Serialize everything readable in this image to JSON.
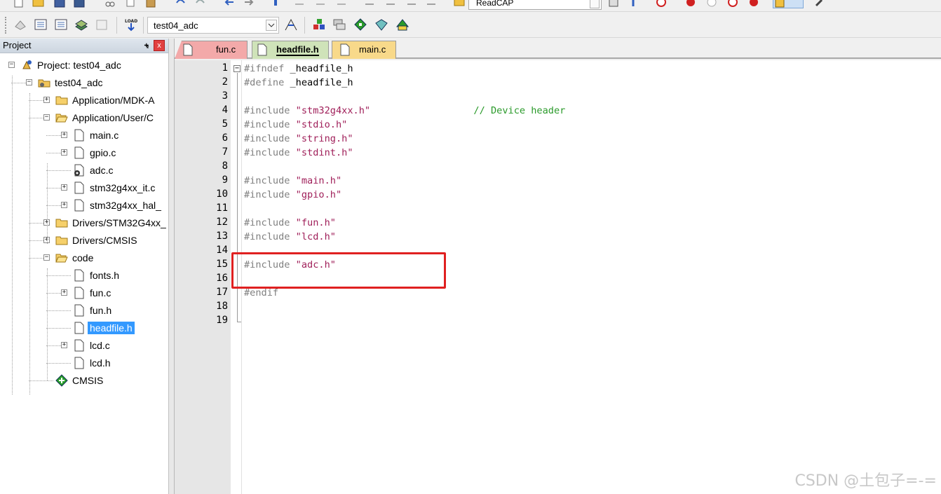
{
  "toolbar_top": {
    "combo_text": "ReadCAP"
  },
  "toolbar": {
    "target_name": "test04_adc",
    "load_label": "LOAD"
  },
  "project_panel": {
    "title": "Project",
    "pin_glyph": "⨧",
    "close_glyph": "x",
    "tree": [
      {
        "label": "Project: test04_adc",
        "icon": "project-icon",
        "level": 0,
        "expander": "−"
      },
      {
        "label": "test04_adc",
        "icon": "target-folder-icon",
        "level": 1,
        "expander": "−"
      },
      {
        "label": "Application/MDK-A",
        "icon": "folder-icon",
        "level": 2,
        "expander": "+"
      },
      {
        "label": "Application/User/C",
        "icon": "folder-open-icon",
        "level": 2,
        "expander": "−"
      },
      {
        "label": "main.c",
        "icon": "file-icon",
        "level": 3,
        "expander": "+"
      },
      {
        "label": "gpio.c",
        "icon": "file-icon",
        "level": 3,
        "expander": "+"
      },
      {
        "label": "adc.c",
        "icon": "file-gear-icon",
        "level": 3,
        "expander": ""
      },
      {
        "label": "stm32g4xx_it.c",
        "icon": "file-icon",
        "level": 3,
        "expander": "+"
      },
      {
        "label": "stm32g4xx_hal_",
        "icon": "file-icon",
        "level": 3,
        "expander": "+"
      },
      {
        "label": "Drivers/STM32G4xx_",
        "icon": "folder-icon",
        "level": 2,
        "expander": "+"
      },
      {
        "label": "Drivers/CMSIS",
        "icon": "folder-icon",
        "level": 2,
        "expander": "+"
      },
      {
        "label": "code",
        "icon": "folder-open-icon",
        "level": 2,
        "expander": "−"
      },
      {
        "label": "fonts.h",
        "icon": "file-icon",
        "level": 3,
        "expander": ""
      },
      {
        "label": "fun.c",
        "icon": "file-icon",
        "level": 3,
        "expander": "+"
      },
      {
        "label": "fun.h",
        "icon": "file-icon",
        "level": 3,
        "expander": ""
      },
      {
        "label": "headfile.h",
        "icon": "file-icon",
        "level": 3,
        "expander": "",
        "selected": true
      },
      {
        "label": "lcd.c",
        "icon": "file-icon",
        "level": 3,
        "expander": "+"
      },
      {
        "label": "lcd.h",
        "icon": "file-icon",
        "level": 3,
        "expander": ""
      },
      {
        "label": "CMSIS",
        "icon": "cmsis-diamond-icon",
        "level": 2,
        "expander": ""
      }
    ]
  },
  "tabs": [
    {
      "label": "fun.c",
      "active": false
    },
    {
      "label": "headfile.h",
      "active": true
    },
    {
      "label": "main.c",
      "active": false
    }
  ],
  "editor": {
    "fold_glyph": "−",
    "lines": [
      {
        "n": "1",
        "segments": [
          {
            "t": "#ifndef ",
            "c": "pp"
          },
          {
            "t": "_headfile_h",
            "c": "plain"
          }
        ]
      },
      {
        "n": "2",
        "segments": [
          {
            "t": "#define ",
            "c": "pp"
          },
          {
            "t": "_headfile_h",
            "c": "plain"
          }
        ]
      },
      {
        "n": "3",
        "segments": []
      },
      {
        "n": "4",
        "segments": [
          {
            "t": "#include ",
            "c": "pp"
          },
          {
            "t": "\"stm32g4xx.h\"",
            "c": "str"
          },
          {
            "t": "                  ",
            "c": "plain"
          },
          {
            "t": "// Device header",
            "c": "cmt"
          }
        ]
      },
      {
        "n": "5",
        "segments": [
          {
            "t": "#include ",
            "c": "pp"
          },
          {
            "t": "\"stdio.h\"",
            "c": "str"
          }
        ]
      },
      {
        "n": "6",
        "segments": [
          {
            "t": "#include ",
            "c": "pp"
          },
          {
            "t": "\"string.h\"",
            "c": "str"
          }
        ]
      },
      {
        "n": "7",
        "segments": [
          {
            "t": "#include ",
            "c": "pp"
          },
          {
            "t": "\"stdint.h\"",
            "c": "str"
          }
        ]
      },
      {
        "n": "8",
        "segments": []
      },
      {
        "n": "9",
        "segments": [
          {
            "t": "#include ",
            "c": "pp"
          },
          {
            "t": "\"main.h\"",
            "c": "str"
          }
        ]
      },
      {
        "n": "10",
        "segments": [
          {
            "t": "#include ",
            "c": "pp"
          },
          {
            "t": "\"gpio.h\"",
            "c": "str"
          }
        ]
      },
      {
        "n": "11",
        "segments": []
      },
      {
        "n": "12",
        "segments": [
          {
            "t": "#include ",
            "c": "pp"
          },
          {
            "t": "\"fun.h\"",
            "c": "str"
          }
        ]
      },
      {
        "n": "13",
        "segments": [
          {
            "t": "#include ",
            "c": "pp"
          },
          {
            "t": "\"lcd.h\"",
            "c": "str"
          }
        ]
      },
      {
        "n": "14",
        "segments": []
      },
      {
        "n": "15",
        "segments": [
          {
            "t": "#include ",
            "c": "pp"
          },
          {
            "t": "\"adc.h\"",
            "c": "str"
          }
        ]
      },
      {
        "n": "16",
        "segments": []
      },
      {
        "n": "17",
        "segments": [
          {
            "t": "#endif",
            "c": "pp"
          }
        ]
      },
      {
        "n": "18",
        "segments": []
      },
      {
        "n": "19",
        "segments": []
      }
    ]
  },
  "watermark": "CSDN @土包子=-=",
  "colors": {
    "preprocessor": "#808080",
    "string": "#a0205a",
    "comment": "#2a9a2a",
    "highlight_box": "#e02020",
    "selection": "#3399ff"
  }
}
